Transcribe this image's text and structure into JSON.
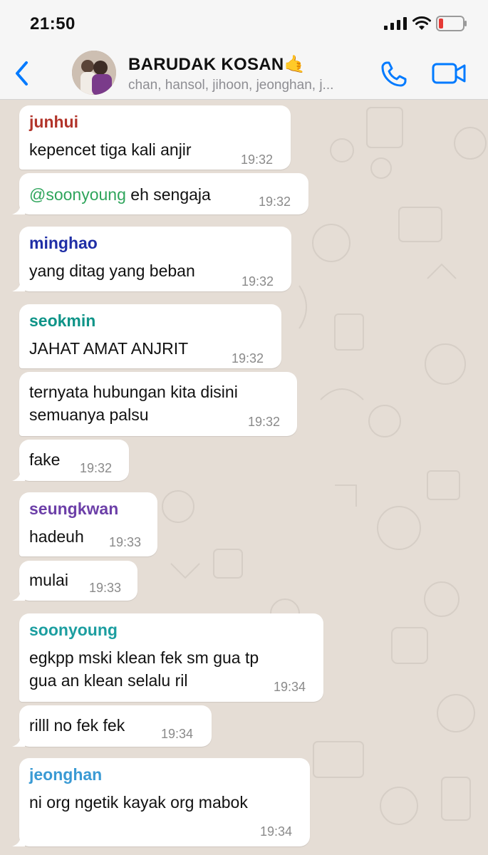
{
  "status_bar": {
    "time": "21:50"
  },
  "header": {
    "title": "BARUDAK KOSAN🤙",
    "subtitle": "chan, hansol, jihoon, jeonghan, j..."
  },
  "colors": {
    "accent": "#007aff",
    "junhui": "#b2342a",
    "minghao": "#1f2ea6",
    "seokmin": "#0f9488",
    "seungkwan": "#6c3fa8",
    "soonyoung": "#1c9ea0",
    "jeonghan": "#3a9ad4",
    "mention": "#2fa55c"
  },
  "messages": [
    {
      "sender": "junhui",
      "lines": [
        "kepencet tiga kali anjir"
      ],
      "time": "19:32"
    },
    {
      "mention": "@soonyoung",
      "text_after": " eh sengaja",
      "time": "19:32"
    },
    {
      "sender": "minghao",
      "lines": [
        "yang ditag yang beban"
      ],
      "time": "19:32"
    },
    {
      "sender": "seokmin",
      "lines": [
        "JAHAT AMAT ANJRIT"
      ],
      "time": "19:32"
    },
    {
      "lines": [
        "ternyata hubungan kita disini",
        "semuanya palsu"
      ],
      "time": "19:32"
    },
    {
      "lines": [
        "fake"
      ],
      "time": "19:32"
    },
    {
      "sender": "seungkwan",
      "lines": [
        "hadeuh"
      ],
      "time": "19:33"
    },
    {
      "lines": [
        "mulai"
      ],
      "time": "19:33"
    },
    {
      "sender": "soonyoung",
      "lines": [
        "egkpp mski klean fek sm gua tp",
        "gua an klean selalu ril"
      ],
      "time": "19:34"
    },
    {
      "lines": [
        "rilll no fek fek"
      ],
      "time": "19:34"
    },
    {
      "sender": "jeonghan",
      "lines": [
        "ni org ngetik kayak org mabok"
      ],
      "time": "19:34"
    }
  ]
}
